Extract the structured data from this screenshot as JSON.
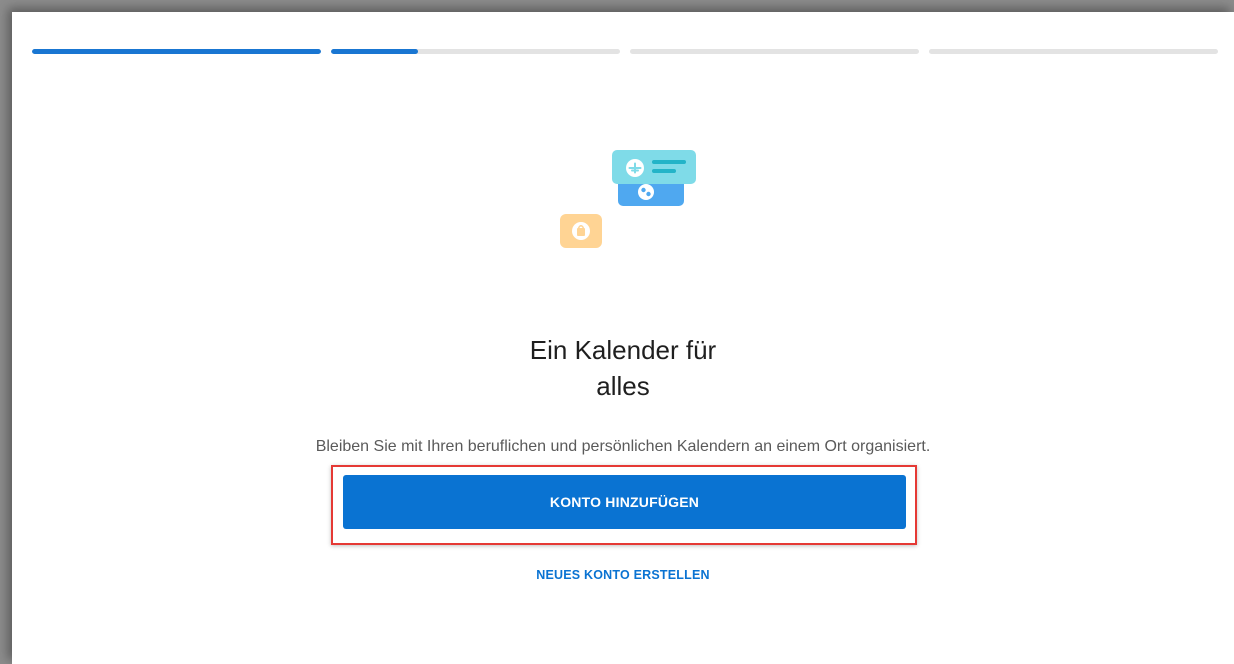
{
  "onboarding": {
    "progress_steps": [
      1.0,
      0.3,
      0.0,
      0.0
    ],
    "title_line1": "Ein Kalender für",
    "title_line2": "alles",
    "subtitle": "Bleiben Sie mit Ihren beruflichen und persönlichen Kalendern an einem Ort organisiert.",
    "primary_button": "KONTO HINZUFÜGEN",
    "secondary_link": "NEUES KONTO ERSTELLEN"
  },
  "illustration": {
    "icons": [
      "airplane-icon",
      "ball-icon",
      "shopping-bag-icon"
    ]
  },
  "colors": {
    "accent": "#0a73d2",
    "progress_track": "#e3e3e3",
    "highlight_border": "#e53935",
    "card_cyan": "#7fdbe8",
    "card_blue": "#4fa8f0",
    "card_orange": "#ffd494"
  }
}
